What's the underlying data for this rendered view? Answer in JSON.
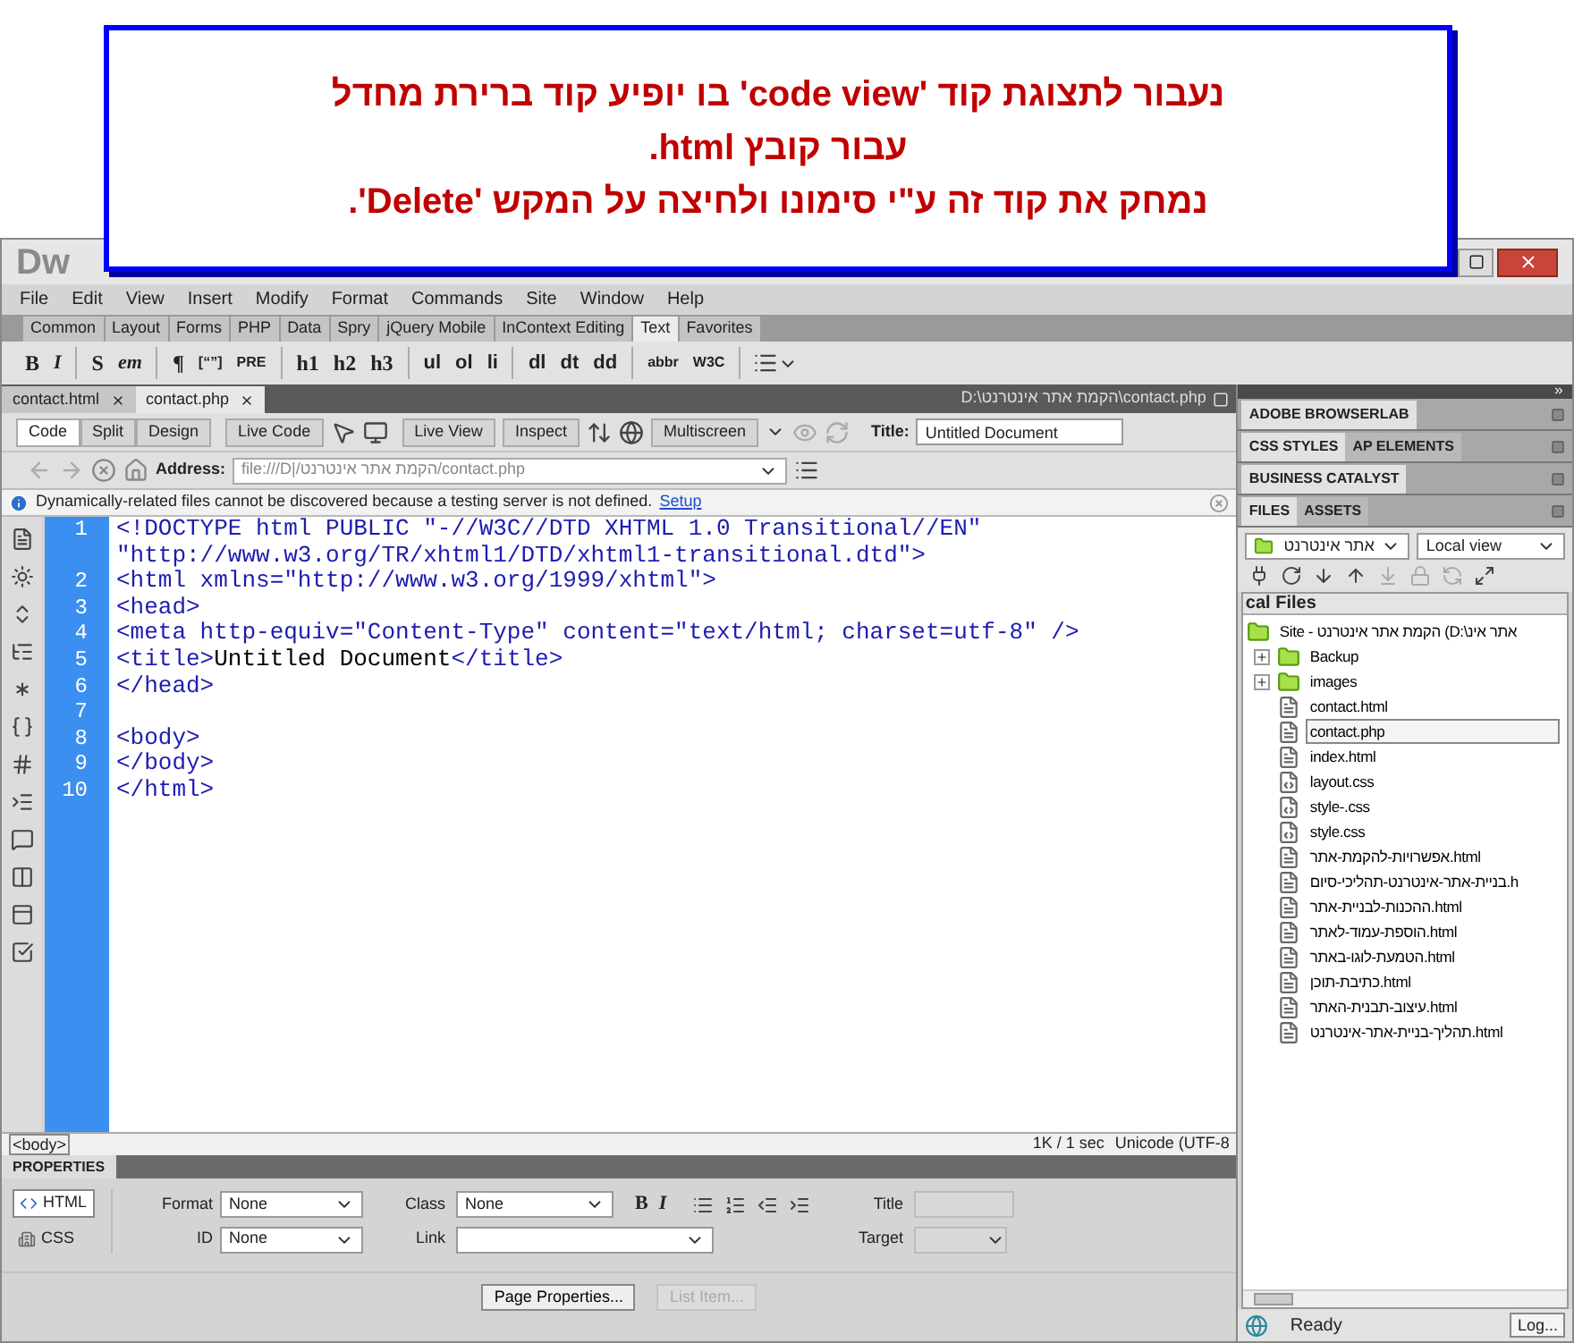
{
  "callout": {
    "lines": [
      "נעבור לתצוגת קוד 'code view' בו יופיע קוד ברירת מחדל",
      "עבור קובץ html.",
      "נמחק את קוד זה ע\"י סימונו ולחיצה על המקש 'Delete'."
    ]
  },
  "window": {
    "logo": "Dw"
  },
  "menu": [
    "File",
    "Edit",
    "View",
    "Insert",
    "Modify",
    "Format",
    "Commands",
    "Site",
    "Window",
    "Help"
  ],
  "insert_tabs": [
    {
      "label": "Common",
      "selected": false
    },
    {
      "label": "Layout",
      "selected": false
    },
    {
      "label": "Forms",
      "selected": false
    },
    {
      "label": "PHP",
      "selected": false
    },
    {
      "label": "Data",
      "selected": false
    },
    {
      "label": "Spry",
      "selected": false
    },
    {
      "label": "jQuery Mobile",
      "selected": false
    },
    {
      "label": "InContext Editing",
      "selected": false
    },
    {
      "label": "Text",
      "selected": true
    },
    {
      "label": "Favorites",
      "selected": false
    }
  ],
  "text_toolbar": [
    [
      {
        "label": "B",
        "kind": "serif"
      },
      {
        "label": "I",
        "kind": "italic"
      }
    ],
    [
      {
        "label": "S",
        "kind": "serif"
      },
      {
        "label": "em",
        "kind": "italic"
      }
    ],
    [
      {
        "label": "¶",
        "kind": "serif"
      },
      {
        "label": "[“”]",
        "kind": "small"
      },
      {
        "label": "PRE",
        "kind": "small"
      }
    ],
    [
      {
        "label": "h1",
        "kind": "serif"
      },
      {
        "label": "h2",
        "kind": "serif"
      },
      {
        "label": "h3",
        "kind": "serif"
      }
    ],
    [
      {
        "label": "ul",
        "kind": "sans"
      },
      {
        "label": "ol",
        "kind": "sans"
      },
      {
        "label": "li",
        "kind": "sans"
      }
    ],
    [
      {
        "label": "dl",
        "kind": "sans"
      },
      {
        "label": "dt",
        "kind": "sans"
      },
      {
        "label": "dd",
        "kind": "sans"
      }
    ],
    [
      {
        "label": "abbr",
        "kind": "small"
      },
      {
        "label": "W3C",
        "kind": "small"
      }
    ]
  ],
  "doc_tabs": [
    {
      "label": "contact.html",
      "selected": false
    },
    {
      "label": "contact.php",
      "selected": true
    }
  ],
  "doc_path": "D:\\הקמת אתר אינטרנט\\contact.php",
  "document_toolbar": {
    "views": [
      {
        "label": "Code",
        "selected": true
      },
      {
        "label": "Split",
        "selected": false
      },
      {
        "label": "Design",
        "selected": false
      }
    ],
    "live_code": "Live Code",
    "live_view": "Live View",
    "inspect": "Inspect",
    "multiscreen": "Multiscreen",
    "title_label": "Title:",
    "title_value": "Untitled Document"
  },
  "address_bar": {
    "label": "Address:",
    "value": "file:///D|/הקמת אתר אינטרנט/contact.php"
  },
  "info_bar": {
    "message": "Dynamically-related files cannot be discovered because a testing server is not defined.",
    "link": "Setup"
  },
  "code_lines": [
    {
      "number": "1",
      "segments": [
        {
          "kind": "tag",
          "text": "<!DOCTYPE html PUBLIC \"-//W3C//DTD XHTML 1.0 Transitional//EN\" \"http://www.w3.org/TR/xhtml1/DTD/xhtml1-transitional.dtd\">"
        }
      ]
    },
    {
      "number": "2",
      "segments": [
        {
          "kind": "tag",
          "text": "<html xmlns=\"http://www.w3.org/1999/xhtml\">"
        }
      ]
    },
    {
      "number": "3",
      "segments": [
        {
          "kind": "tag",
          "text": "<head>"
        }
      ]
    },
    {
      "number": "4",
      "segments": [
        {
          "kind": "tag",
          "text": "<meta http-equiv=\"Content-Type\" content=\"text/html; charset=utf-8\" />"
        }
      ]
    },
    {
      "number": "5",
      "segments": [
        {
          "kind": "tag",
          "text": "<title>"
        },
        {
          "kind": "text",
          "text": "Untitled Document"
        },
        {
          "kind": "tag",
          "text": "</title>"
        }
      ]
    },
    {
      "number": "6",
      "segments": [
        {
          "kind": "tag",
          "text": "</head>"
        }
      ]
    },
    {
      "number": "7"
    },
    {
      "number": "8",
      "segments": [
        {
          "kind": "tag",
          "text": "<body>"
        }
      ]
    },
    {
      "number": "9",
      "segments": [
        {
          "kind": "tag",
          "text": "</body>"
        }
      ]
    },
    {
      "number": "10",
      "segments": [
        {
          "kind": "tag",
          "text": "</html>"
        }
      ]
    }
  ],
  "tag_selector": "<body>",
  "doc_status": {
    "size": "1K / 1 sec",
    "encoding": "Unicode (UTF-8"
  },
  "properties": {
    "title": "PROPERTIES",
    "modes": [
      {
        "label": "HTML",
        "kind": "html",
        "selected": true
      },
      {
        "label": "CSS",
        "kind": "css",
        "selected": false
      }
    ],
    "format_label": "Format",
    "format_value": "None",
    "id_label": "ID",
    "id_value": "None",
    "class_label": "Class",
    "class_value": "None",
    "bold": "B",
    "italic": "I",
    "link_label": "Link",
    "title_label": "Title",
    "title_disabled": true,
    "target_label": "Target",
    "target_disabled": true,
    "buttons": [
      {
        "label": "Page Properties...",
        "disabled": false
      },
      {
        "label": "List Item...",
        "disabled": true
      }
    ]
  },
  "panel_groups": [
    {
      "tabs": [
        {
          "label": "ADOBE BROWSERLAB",
          "selected": true
        }
      ]
    },
    {
      "tabs": [
        {
          "label": "CSS STYLES",
          "selected": true
        },
        {
          "label": "AP ELEMENTS",
          "selected": false
        }
      ]
    },
    {
      "tabs": [
        {
          "label": "BUSINESS CATALYST",
          "selected": true
        }
      ]
    },
    {
      "tabs": [
        {
          "label": "FILES",
          "selected": true
        },
        {
          "label": "ASSETS",
          "selected": false
        }
      ]
    }
  ],
  "files": {
    "site": "אתר אינטרנט",
    "view": "Local view",
    "header": "cal Files",
    "tree": {
      "label": "Site - הקמת אתר אינטרנט (D:\\אתר אינ",
      "kind": "site",
      "children": [
        {
          "label": "Backup",
          "kind": "folder",
          "expanded": false,
          "selected": false
        },
        {
          "label": "images",
          "kind": "folder",
          "expanded": false,
          "selected": false
        },
        {
          "label": "contact.html",
          "kind": "page",
          "selected": false
        },
        {
          "label": "contact.php",
          "kind": "page",
          "selected": true
        },
        {
          "label": "index.html",
          "kind": "page",
          "selected": false
        },
        {
          "label": "layout.css",
          "kind": "css",
          "selected": false
        },
        {
          "label": "style-.css",
          "kind": "css",
          "selected": false
        },
        {
          "label": "style.css",
          "kind": "css",
          "selected": false
        },
        {
          "label": "אפשרויות-להקמת-אתר.html",
          "kind": "page",
          "selected": false
        },
        {
          "label": "בניית-אתר-אינטרנט-תהליכי-סיום.h",
          "kind": "page",
          "selected": false
        },
        {
          "label": "ההכנות-לבניית-אתר.html",
          "kind": "page",
          "selected": false
        },
        {
          "label": "הוספת-עמוד-לאתר.html",
          "kind": "page",
          "selected": false
        },
        {
          "label": "הטמעת-לוגו-באתר.html",
          "kind": "page",
          "selected": false
        },
        {
          "label": "כתיבת-תוכן.html",
          "kind": "page",
          "selected": false
        },
        {
          "label": "עיצוב-תבנית-האתר.html",
          "kind": "page",
          "selected": false
        },
        {
          "label": "תהליך-בניית-אתר-אינטרנט.html",
          "kind": "page",
          "selected": false
        }
      ]
    }
  },
  "status": {
    "text": "Ready",
    "log": "Log..."
  }
}
